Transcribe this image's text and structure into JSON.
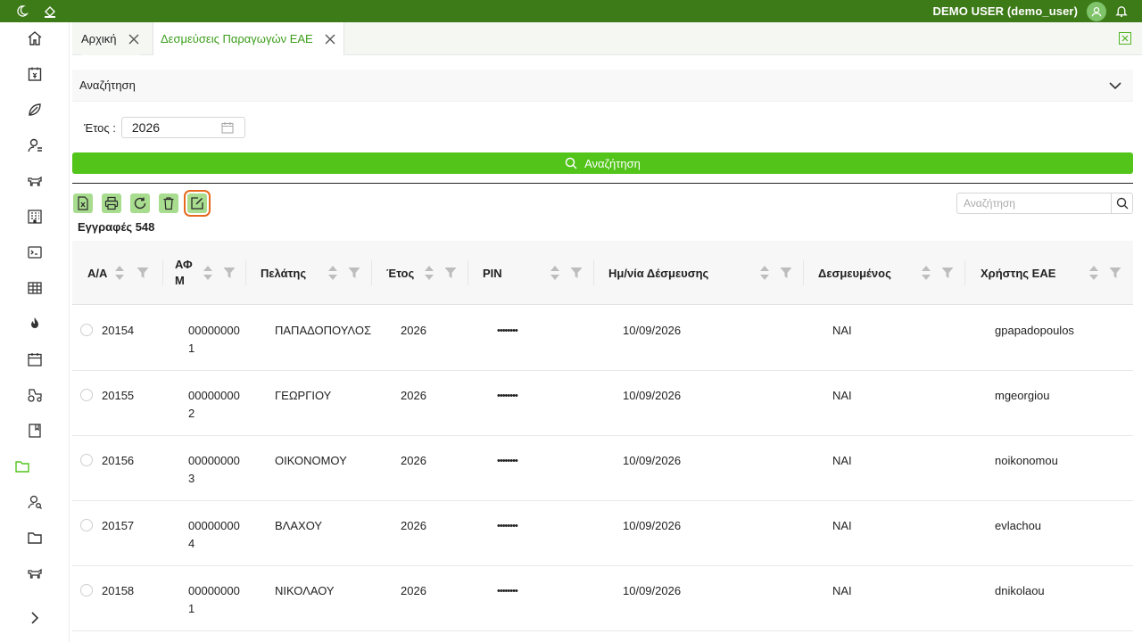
{
  "topbar": {
    "user_label": "DEMO USER (demo_user)",
    "icons": [
      "moon-icon",
      "paint-bucket-icon",
      "user-avatar-icon",
      "bell-icon"
    ]
  },
  "sidebar": {
    "items": [
      "home",
      "invoice",
      "leaf",
      "users",
      "cow",
      "building",
      "terminal",
      "table",
      "fire",
      "calendar",
      "tractor",
      "book",
      "folder-active",
      "user-search",
      "folder",
      "cow",
      "expand"
    ],
    "active_color": "#52c41a"
  },
  "tabs": [
    {
      "label": "Αρχική"
    },
    {
      "label": "Δεσμεύσεις Παραγωγών ΕΑΕ"
    }
  ],
  "search_panel": {
    "title": "Αναζήτηση",
    "year_label": "Έτος :",
    "year_value": "2026",
    "search_button": "Αναζήτηση"
  },
  "toolbar": {
    "buttons": [
      "excel-export",
      "print",
      "refresh",
      "delete",
      "edit"
    ],
    "search_placeholder": "Αναζήτηση"
  },
  "records_label": "Εγγραφές 548",
  "table": {
    "columns": [
      "Α/Α",
      "ΑΦΜ",
      "Πελάτης",
      "Έτος",
      "PIN",
      "Ημ/νία Δέσμευσης",
      "Δεσμευμένος",
      "Χρήστης ΕΑΕ"
    ],
    "rows": [
      {
        "aa": "20154",
        "afm1": "00000000",
        "afm2": "1",
        "client": "ΠΑΠΑΔΟΠΟΥΛΟΣ",
        "year": "2026",
        "pin": "••••••••",
        "date": "10/09/2026",
        "reserved": "ΝΑΙ",
        "user": "gpapadopoulos"
      },
      {
        "aa": "20155",
        "afm1": "00000000",
        "afm2": "2",
        "client": "ΓΕΩΡΓΙΟΥ",
        "year": "2026",
        "pin": "••••••••",
        "date": "10/09/2026",
        "reserved": "ΝΑΙ",
        "user": "mgeorgiou"
      },
      {
        "aa": "20156",
        "afm1": "00000000",
        "afm2": "3",
        "client": "ΟΙΚΟΝΟΜΟΥ",
        "year": "2026",
        "pin": "••••••••",
        "date": "10/09/2026",
        "reserved": "ΝΑΙ",
        "user": "noikonomou"
      },
      {
        "aa": "20157",
        "afm1": "00000000",
        "afm2": "4",
        "client": "ΒΛΑΧΟΥ",
        "year": "2026",
        "pin": "••••••••",
        "date": "10/09/2026",
        "reserved": "ΝΑΙ",
        "user": "evlachou"
      },
      {
        "aa": "20158",
        "afm1": "00000000",
        "afm2": "1",
        "client": "ΝΙΚΟΛΑΟΥ",
        "year": "2026",
        "pin": "••••••••",
        "date": "10/09/2026",
        "reserved": "ΝΑΙ",
        "user": "dnikolaou"
      }
    ]
  },
  "colors": {
    "topbar": "#3d7a18",
    "accent": "#52c41a",
    "toolbar_button": "#a8dc8e",
    "highlight": "#e66a1f"
  }
}
